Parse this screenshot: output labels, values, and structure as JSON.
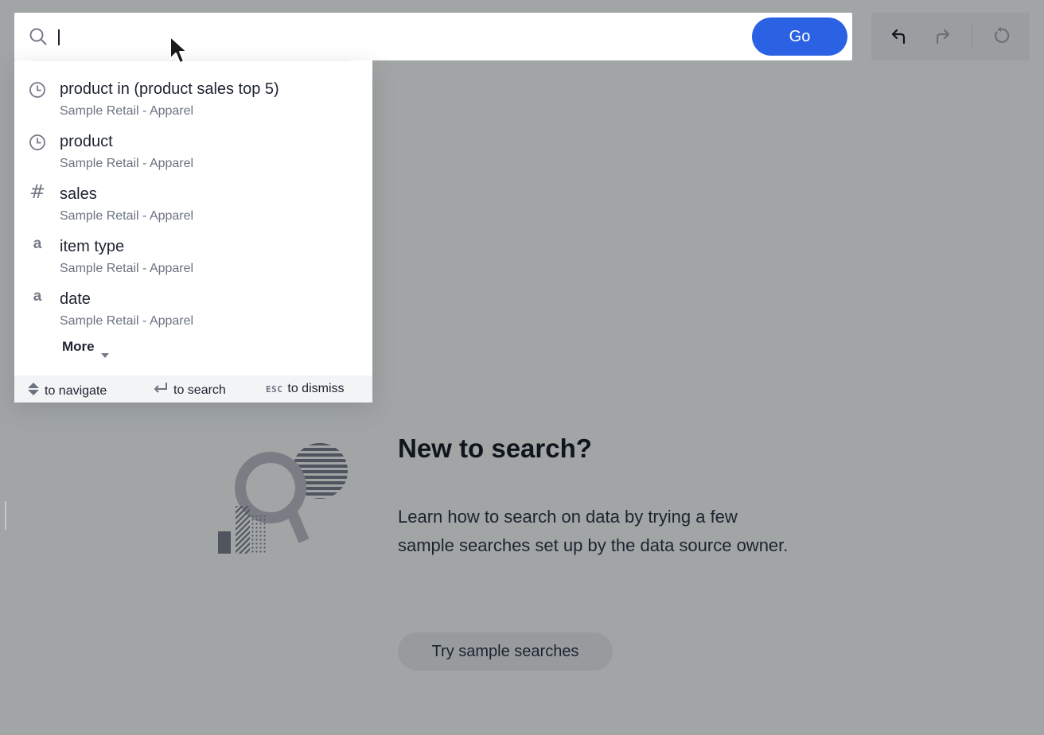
{
  "search": {
    "value": "",
    "go_label": "Go"
  },
  "history": {
    "undo_icon": "undo-icon",
    "redo_icon": "redo-icon",
    "reset_icon": "reset-icon"
  },
  "suggestions": [
    {
      "icon": "clock-icon",
      "title": "product in (product sales top 5)",
      "source": "Sample Retail - Apparel"
    },
    {
      "icon": "clock-icon",
      "title": "product",
      "source": "Sample Retail - Apparel"
    },
    {
      "icon": "hash-icon",
      "glyph": "#",
      "title": "sales",
      "source": "Sample Retail - Apparel"
    },
    {
      "icon": "text-attribute-icon",
      "glyph": "a",
      "title": "item type",
      "source": "Sample Retail - Apparel"
    },
    {
      "icon": "text-attribute-icon",
      "glyph": "a",
      "title": "date",
      "source": "Sample Retail - Apparel"
    }
  ],
  "more_label": "More",
  "footer": {
    "navigate": "to navigate",
    "search": "to search",
    "esc_key": "ESC",
    "dismiss": "to dismiss"
  },
  "empty_state": {
    "title": "New to search?",
    "description": "Learn how to search on data by trying a few sample searches set up by the data source owner.",
    "button_label": "Try sample searches"
  },
  "colors": {
    "accent": "#2b62e3",
    "overlay": "#a1a5a5",
    "icon_gray": "#757a86",
    "subtext": "#6b7280"
  }
}
